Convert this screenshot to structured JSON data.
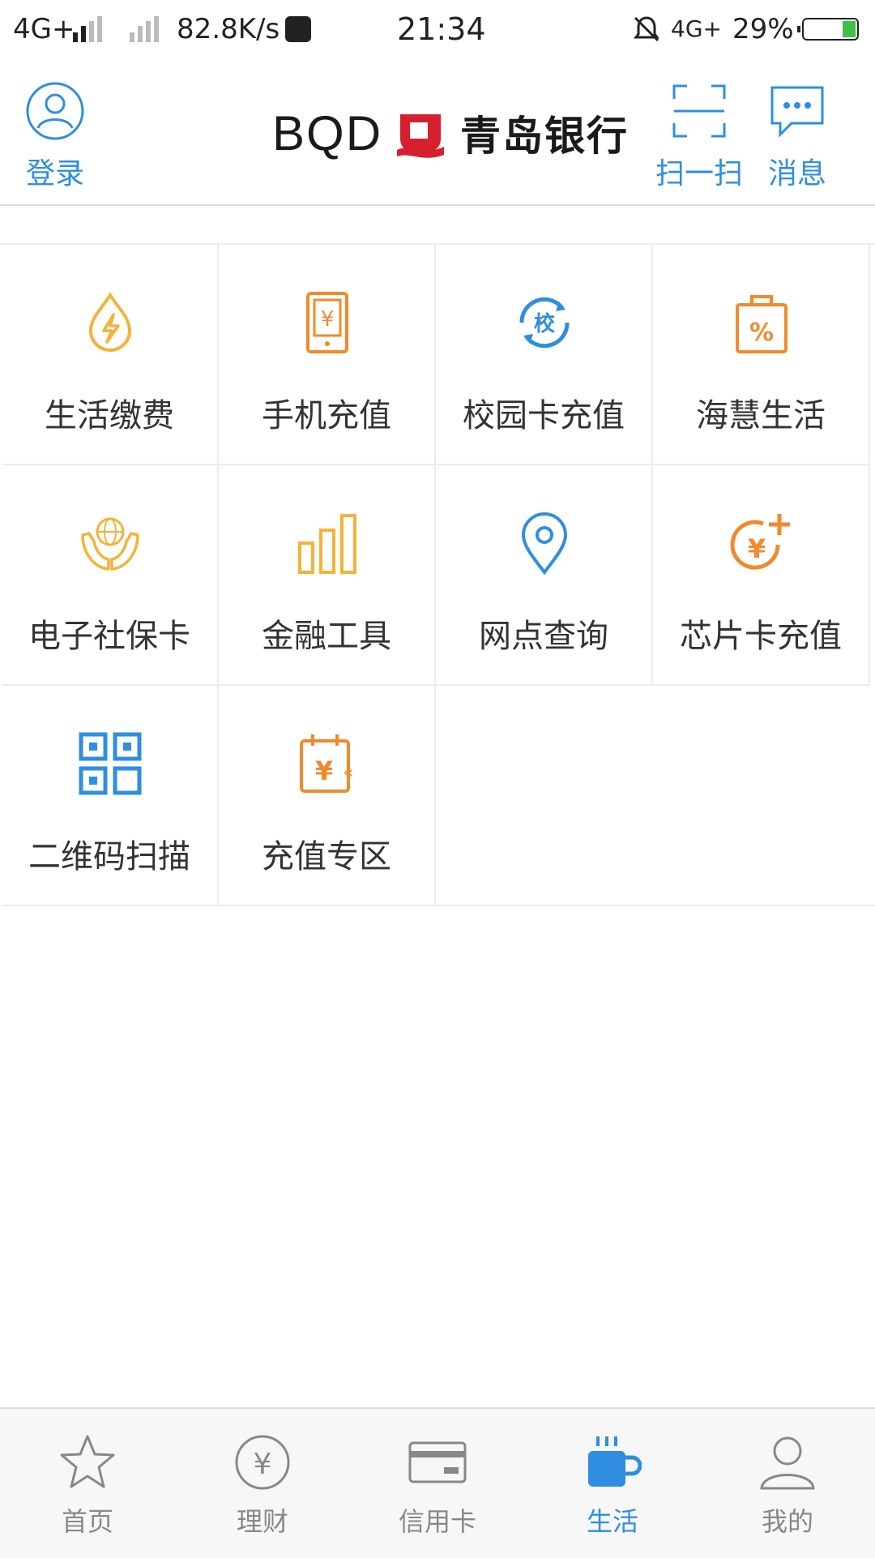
{
  "status_bar": {
    "network1": "4G+",
    "speed": "82.8K/s",
    "time": "21:34",
    "network2": "4G",
    "battery": "29%"
  },
  "header": {
    "login_label": "登录",
    "logo_text": "BQD",
    "bank_name": "青岛银行",
    "scan_label": "扫一扫",
    "message_label": "消息"
  },
  "services": [
    {
      "label": "生活缴费",
      "icon": "water-drop-lightning-icon"
    },
    {
      "label": "手机充值",
      "icon": "phone-yuan-icon"
    },
    {
      "label": "校园卡充值",
      "icon": "campus-card-icon"
    },
    {
      "label": "海慧生活",
      "icon": "shopping-bag-percent-icon"
    },
    {
      "label": "电子社保卡",
      "icon": "hands-globe-icon"
    },
    {
      "label": "金融工具",
      "icon": "bar-chart-icon"
    },
    {
      "label": "网点查询",
      "icon": "location-pin-icon"
    },
    {
      "label": "芯片卡充值",
      "icon": "yuan-plus-icon"
    },
    {
      "label": "二维码扫描",
      "icon": "qr-code-icon"
    },
    {
      "label": "充值专区",
      "icon": "calendar-yuan-icon"
    }
  ],
  "tabs": [
    {
      "label": "首页",
      "icon": "star-icon",
      "active": false
    },
    {
      "label": "理财",
      "icon": "yuan-circle-icon",
      "active": false
    },
    {
      "label": "信用卡",
      "icon": "credit-card-icon",
      "active": false
    },
    {
      "label": "生活",
      "icon": "coffee-cup-icon",
      "active": true
    },
    {
      "label": "我的",
      "icon": "user-icon",
      "active": false
    }
  ],
  "colors": {
    "accent": "#2f8ee0",
    "orange": "#f08a2c",
    "yellow": "#f3b33a",
    "red_logo": "#d6202e"
  }
}
